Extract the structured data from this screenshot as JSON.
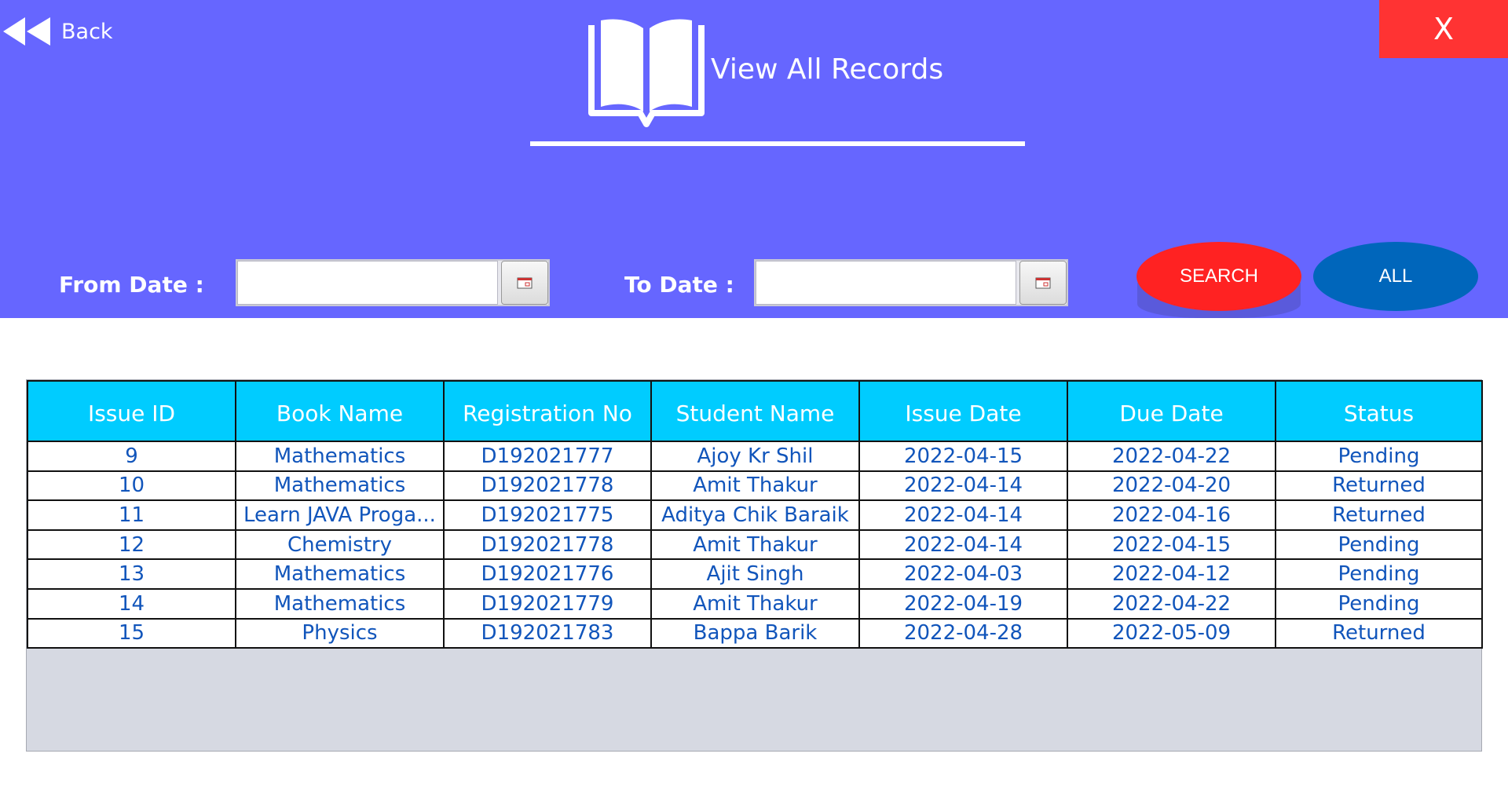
{
  "header": {
    "back_label": "Back",
    "close_label": "X",
    "title": "View All Records",
    "bg_color": "#6666ff"
  },
  "filters": {
    "from_label": "From Date :",
    "from_value": "",
    "to_label": "To Date :",
    "to_value": "",
    "search_label": "SEARCH",
    "all_label": "ALL"
  },
  "colors": {
    "search_button": "#ff2222",
    "all_button": "#0066bb",
    "close_button": "#ff3333",
    "table_header": "#00ccff",
    "cell_text": "#1155bb"
  },
  "table": {
    "columns": [
      "Issue ID",
      "Book Name",
      "Registration No",
      "Student Name",
      "Issue Date",
      "Due Date",
      "Status"
    ],
    "rows": [
      [
        "9",
        "Mathematics",
        "D192021777",
        "Ajoy Kr Shil",
        "2022-04-15",
        "2022-04-22",
        "Pending"
      ],
      [
        "10",
        "Mathematics",
        "D192021778",
        "Amit Thakur",
        "2022-04-14",
        "2022-04-20",
        "Returned"
      ],
      [
        "11",
        "Learn JAVA Proga...",
        "D192021775",
        "Aditya Chik Baraik",
        "2022-04-14",
        "2022-04-16",
        "Returned"
      ],
      [
        "12",
        "Chemistry",
        "D192021778",
        "Amit Thakur",
        "2022-04-14",
        "2022-04-15",
        "Pending"
      ],
      [
        "13",
        "Mathematics",
        "D192021776",
        "Ajit Singh",
        "2022-04-03",
        "2022-04-12",
        "Pending"
      ],
      [
        "14",
        "Mathematics",
        "D192021779",
        "Amit Thakur",
        "2022-04-19",
        "2022-04-22",
        "Pending"
      ],
      [
        "15",
        "Physics",
        "D192021783",
        "Bappa Barik",
        "2022-04-28",
        "2022-05-09",
        "Returned"
      ]
    ]
  },
  "icons": {
    "back": "rewind-icon",
    "book": "open-book-icon",
    "calendar": "calendar-icon"
  }
}
